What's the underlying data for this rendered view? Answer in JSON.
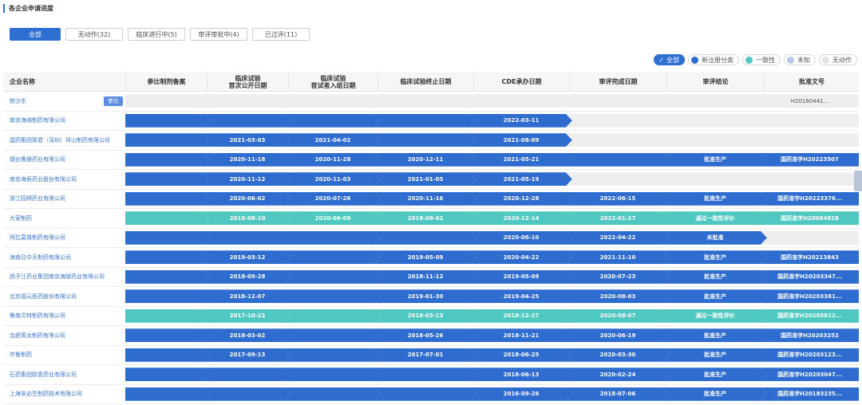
{
  "title": "各企业申请进度",
  "tabs": [
    {
      "label": "全部",
      "active": true
    },
    {
      "label": "无动作(32)",
      "active": false
    },
    {
      "label": "临床进行中(5)",
      "active": false
    },
    {
      "label": "审评审批中(4)",
      "active": false
    },
    {
      "label": "已过评(11)",
      "active": false
    }
  ],
  "legend": [
    {
      "label": "全部",
      "active": true,
      "check": "✓"
    },
    {
      "label": "新注册分类",
      "color": "#2e6ccf"
    },
    {
      "label": "一致性",
      "color": "#4fc8c2"
    },
    {
      "label": "未知",
      "color": "#b7c7e6"
    },
    {
      "label": "无动作",
      "color": "#e3e3e3"
    }
  ],
  "columns": [
    "企业名称",
    "参比制剂备案",
    "临床试验\n首次公开日期",
    "临床试验\n首试者入组日期",
    "临床试验终止日期",
    "CDE承办日期",
    "审评完成日期",
    "审评结论",
    "批准文号"
  ],
  "rows": [
    {
      "name": "默沙东",
      "tag": "参比",
      "color": "grey",
      "cells": [
        "",
        "",
        "",
        "",
        "",
        "",
        "",
        "H20160441..."
      ]
    },
    {
      "name": "南京海纳制药有限公司",
      "color": "blue",
      "cells": [
        "",
        "",
        "",
        "",
        "2022-03-11",
        "",
        "",
        ""
      ],
      "to": 5
    },
    {
      "name": "国药集团致君（深圳）坪山制药有限公司",
      "color": "blue",
      "cells": [
        "",
        "2021-03-03",
        "2021-04-02",
        "",
        "2021-08-09",
        "",
        "",
        ""
      ],
      "to": 5
    },
    {
      "name": "烟台鲁银药业有限公司",
      "color": "blue",
      "cells": [
        "",
        "2020-11-18",
        "2020-11-28",
        "2020-12-11",
        "2021-05-21",
        "",
        "批准生产",
        "国药准字H20223507"
      ],
      "to": 8
    },
    {
      "name": "南京海辰药业股份有限公司",
      "color": "blue",
      "cells": [
        "",
        "2020-11-12",
        "2020-11-03",
        "2021-01-05",
        "2021-05-19",
        "",
        "",
        ""
      ],
      "to": 5
    },
    {
      "name": "浙江园得药业有限公司",
      "color": "blue",
      "cells": [
        "",
        "2020-06-02",
        "2020-07-26",
        "2020-11-16",
        "2020-12-28",
        "2022-06-15",
        "批准生产",
        "国药准字H20223376..."
      ],
      "to": 8
    },
    {
      "name": "大家制药",
      "color": "teal",
      "cells": [
        "",
        "2018-08-10",
        "2020-06-09",
        "2018-08-02",
        "2020-12-14",
        "2022-01-27",
        "通过一致性评价",
        "国药准字H20064828"
      ],
      "to": 8
    },
    {
      "name": "阿拉莫普制药有限公司",
      "color": "blue",
      "cells": [
        "",
        "",
        "",
        "",
        "2020-06-10",
        "2022-04-22",
        "未批准",
        ""
      ],
      "to": 7
    },
    {
      "name": "海南日中天制药有限公司",
      "color": "blue",
      "cells": [
        "",
        "2019-03-12",
        "",
        "2019-05-09",
        "2020-04-22",
        "2021-11-10",
        "批准生产",
        "国药准字H20213843"
      ],
      "to": 8
    },
    {
      "name": "扬子江药业集团南京海陵药业有限公司",
      "color": "blue",
      "cells": [
        "",
        "2018-09-28",
        "",
        "2018-11-12",
        "2019-05-09",
        "2020-07-23",
        "批准生产",
        "国药准字H20203347..."
      ],
      "to": 8
    },
    {
      "name": "北京福元医药股份有限公司",
      "color": "blue",
      "cells": [
        "",
        "2018-12-07",
        "",
        "2019-01-30",
        "2019-04-25",
        "2020-08-03",
        "批准生产",
        "国药准字H20203381..."
      ],
      "to": 8
    },
    {
      "name": "鲁南贝特制药有限公司",
      "color": "teal",
      "cells": [
        "",
        "2017-10-22",
        "",
        "2018-03-13",
        "2018-12-27",
        "2020-08-07",
        "通过一致性评价",
        "国药准字H20205812..."
      ],
      "to": 8
    },
    {
      "name": "合肥英太制药有限公司",
      "color": "blue",
      "cells": [
        "",
        "2018-03-02",
        "",
        "2018-05-26",
        "2018-11-21",
        "2020-06-19",
        "批准生产",
        "国药准字H20203252"
      ],
      "to": 8
    },
    {
      "name": "齐鲁制药",
      "color": "blue",
      "cells": [
        "",
        "2017-09-13",
        "",
        "2017-07-01",
        "2018-06-25",
        "2020-03-30",
        "批准生产",
        "国药准字H20203123..."
      ],
      "to": 8
    },
    {
      "name": "石药集团欧意药业有限公司",
      "color": "blue",
      "cells": [
        "",
        "",
        "",
        "",
        "2018-06-13",
        "2020-02-24",
        "批准生产",
        "国药准字H20203047..."
      ],
      "to": 8
    },
    {
      "name": "上海安必生制药技术有限公司",
      "color": "blue",
      "cells": [
        "",
        "",
        "",
        "",
        "2016-09-26",
        "2018-07-06",
        "批准生产",
        "国药准字H20183235..."
      ],
      "to": 8
    }
  ]
}
